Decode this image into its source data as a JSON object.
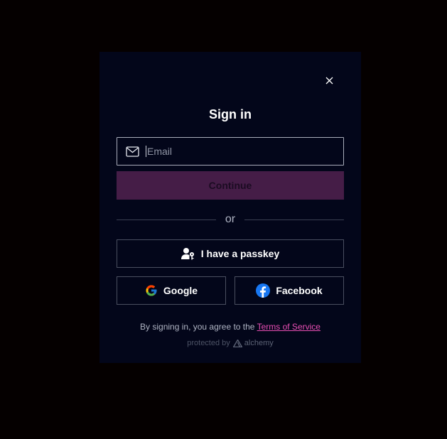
{
  "modal": {
    "title": "Sign in",
    "close_icon": "close-icon",
    "email": {
      "icon": "mail-icon",
      "placeholder": "Email",
      "value": ""
    },
    "continue_label": "Continue",
    "divider_label": "or",
    "passkey": {
      "icon": "user-key-icon",
      "label": "I have a passkey"
    },
    "google": {
      "icon": "google-icon",
      "label": "Google"
    },
    "facebook": {
      "icon": "facebook-icon",
      "label": "Facebook"
    },
    "terms": {
      "prefix": "By signing in, you agree to the",
      "link": "Terms of Service"
    },
    "protected": {
      "prefix": "protected by",
      "brand": "alchemy",
      "brand_icon": "alchemy-logo-icon"
    }
  },
  "colors": {
    "background": "#050000",
    "modal_background": "#03061a",
    "continue_background": "#451d47",
    "link": "#ea4fb5",
    "text_primary": "#ffffff",
    "text_secondary": "#aeb3c2"
  }
}
